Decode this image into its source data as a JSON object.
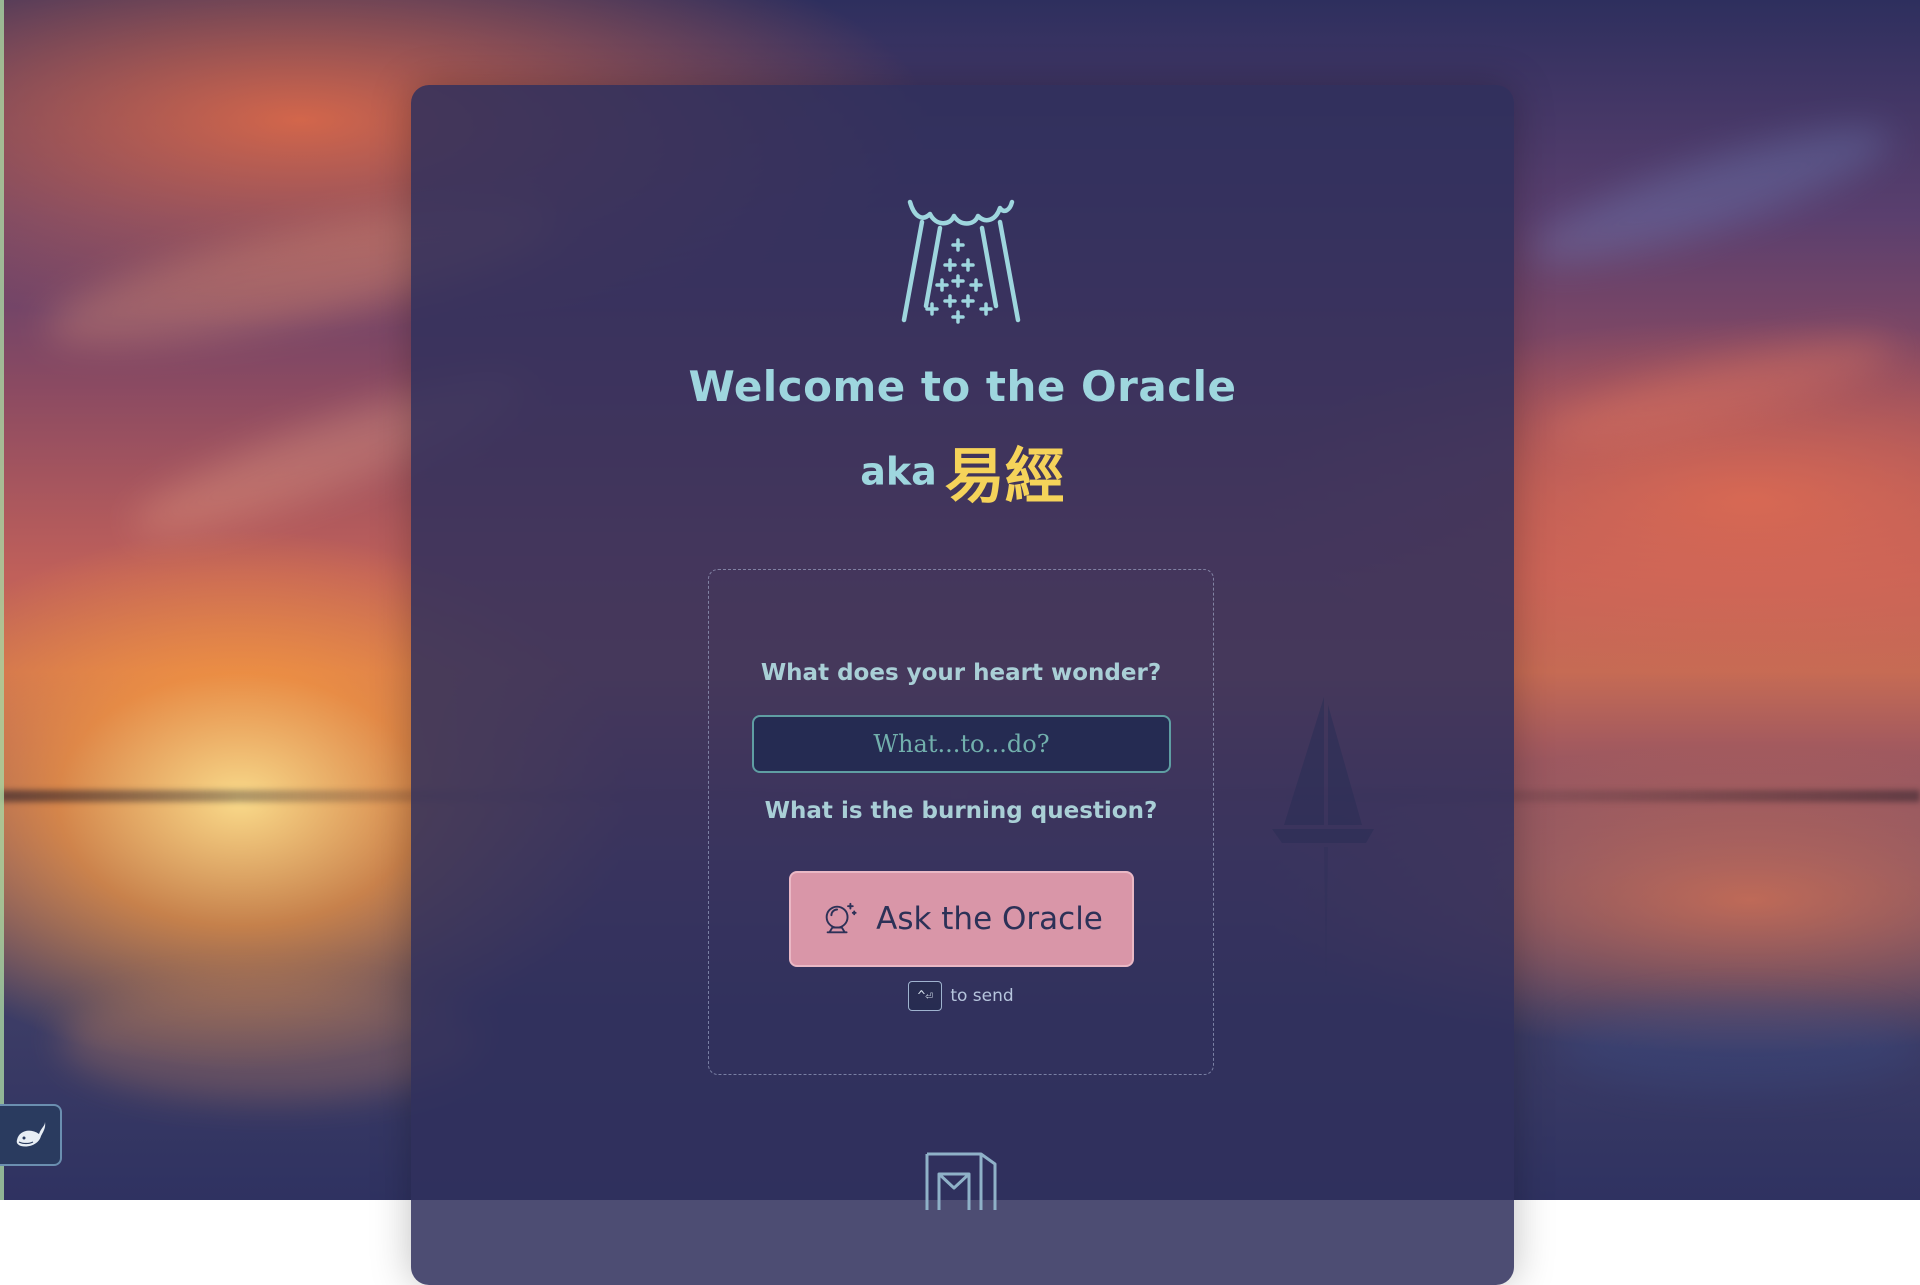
{
  "app": {
    "title": "Welcome to the Oracle",
    "subtitle_prefix": "aka",
    "subtitle_hanzi": "易經"
  },
  "form": {
    "prompt_label": "What does your heart wonder?",
    "input_placeholder": "What...to...do?",
    "input_value": "",
    "question_label": "What is the burning question?",
    "submit_label": "Ask the Oracle",
    "shortcut_key": "^⏎",
    "shortcut_hint": "to send"
  },
  "icons": {
    "header_logo": "oracle-temple-icon",
    "submit_icon": "crystal-ball-icon",
    "footer_logo": "book-logo-icon",
    "side_button": "whale-icon"
  },
  "colors": {
    "title": "#9ed6de",
    "hanzi": "#f5d35a",
    "button": "#d996a8",
    "panel": "#30305c",
    "input_border": "#5f9ea3"
  }
}
